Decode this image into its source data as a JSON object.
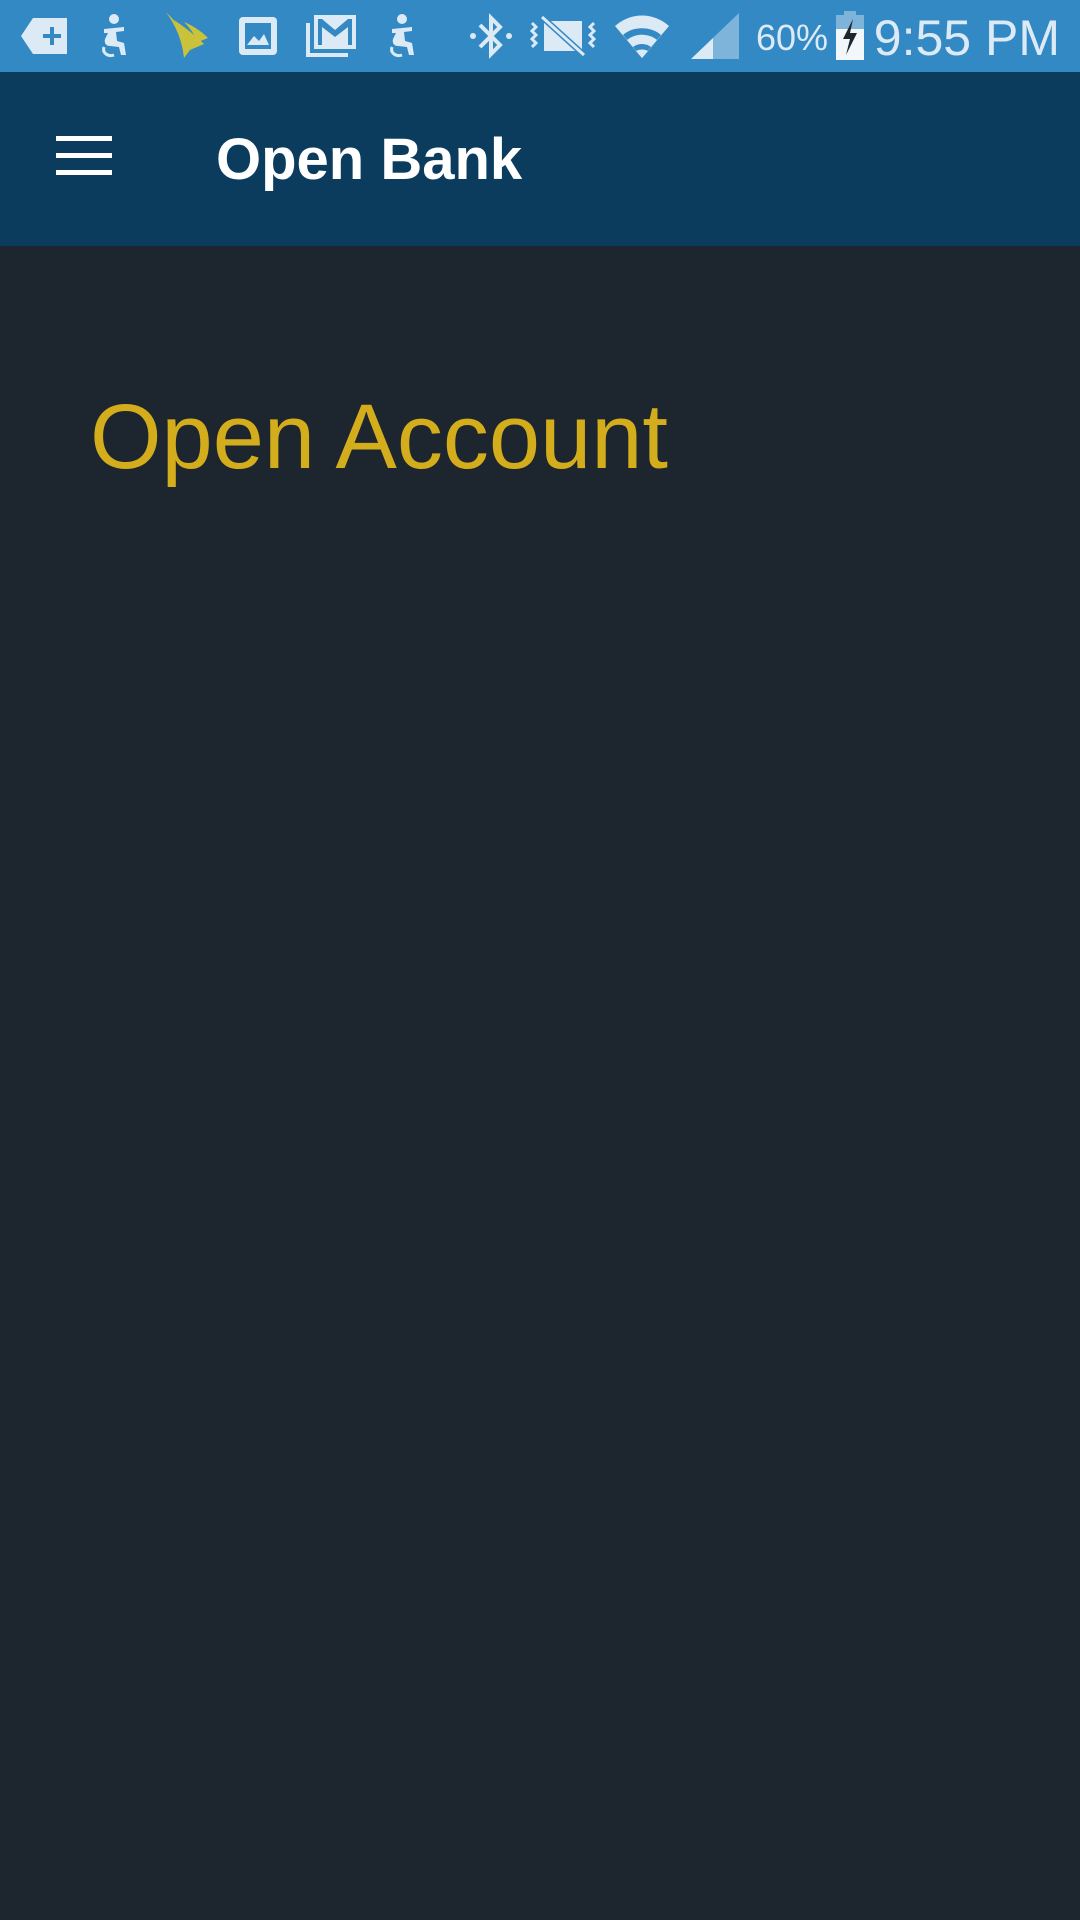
{
  "status_bar": {
    "icons": [
      "add-tag-icon",
      "accessibility-person-icon",
      "sprint-logo-icon",
      "gallery-image-icon",
      "gmail-icon",
      "accessibility-person-icon",
      "bluetooth-icon",
      "vibrate-off-icon",
      "wifi-icon",
      "cell-signal-icon",
      "battery-charging-icon"
    ],
    "battery_percent": "60%",
    "time": "9:55 PM",
    "colors": {
      "background": "#3389c4",
      "icon": "#dceaf5",
      "sprint_logo": "#c9c23a"
    }
  },
  "app_bar": {
    "title": "Open Bank",
    "menu_icon": "hamburger-menu-icon",
    "background": "#0b3c5e"
  },
  "main": {
    "heading": "Open Account",
    "heading_color": "#d3ad1b",
    "background": "#1d252e"
  }
}
